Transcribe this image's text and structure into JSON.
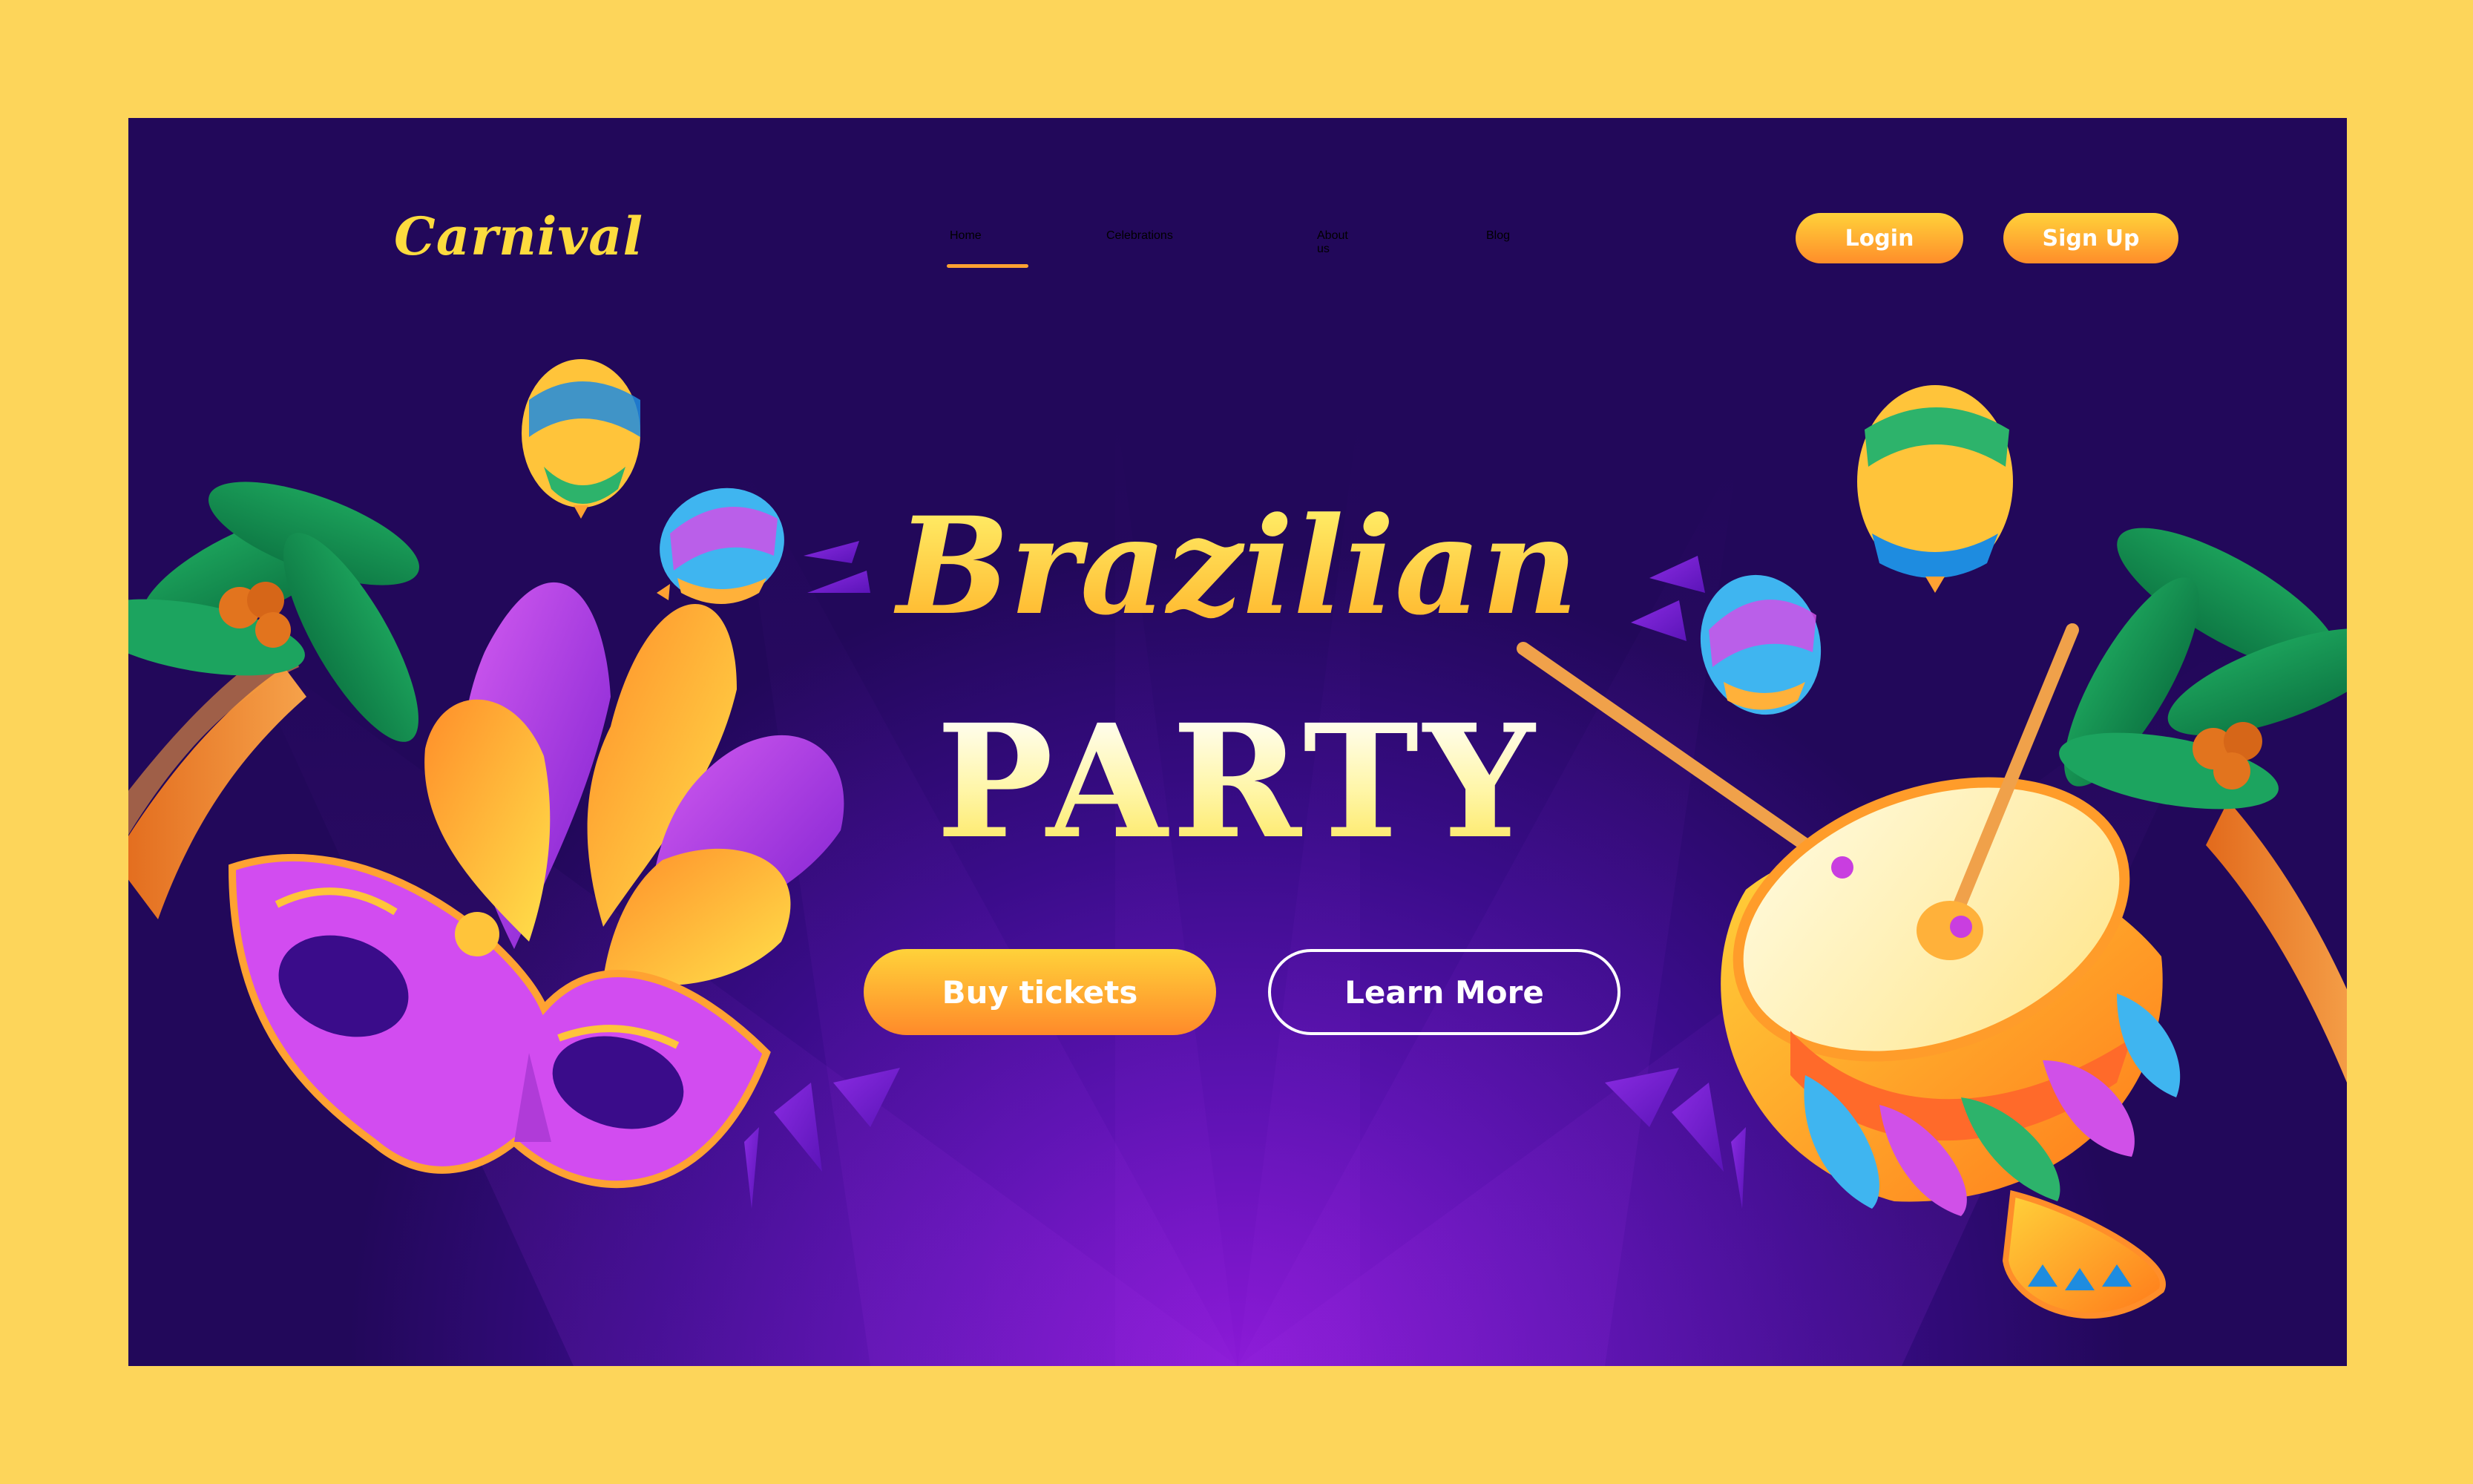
{
  "brand": {
    "logo": "Carnival"
  },
  "nav": {
    "items": [
      {
        "label": "Home",
        "active": true
      },
      {
        "label": "Celebrations",
        "active": false
      },
      {
        "label": "About us",
        "active": false
      },
      {
        "label": "Blog",
        "active": false
      }
    ]
  },
  "auth": {
    "login_label": "Login",
    "signup_label": "Sign Up"
  },
  "hero": {
    "title_line1": "Brazilian",
    "title_line2": "PARTY",
    "primary_cta": "Buy tickets",
    "secondary_cta": "Learn More"
  },
  "icons": [
    "palm-tree-icon",
    "balloon-icon",
    "carnival-mask-icon",
    "feather-icon",
    "drum-icon",
    "confetti-icon"
  ],
  "colors": {
    "page_border": "#FDD55A",
    "background_dark": "#22085A",
    "background_glow": "#8A18D6",
    "accent_orange": "#FF8E2A",
    "accent_yellow": "#FFD23A",
    "logo_yellow": "#FDDB3E"
  }
}
